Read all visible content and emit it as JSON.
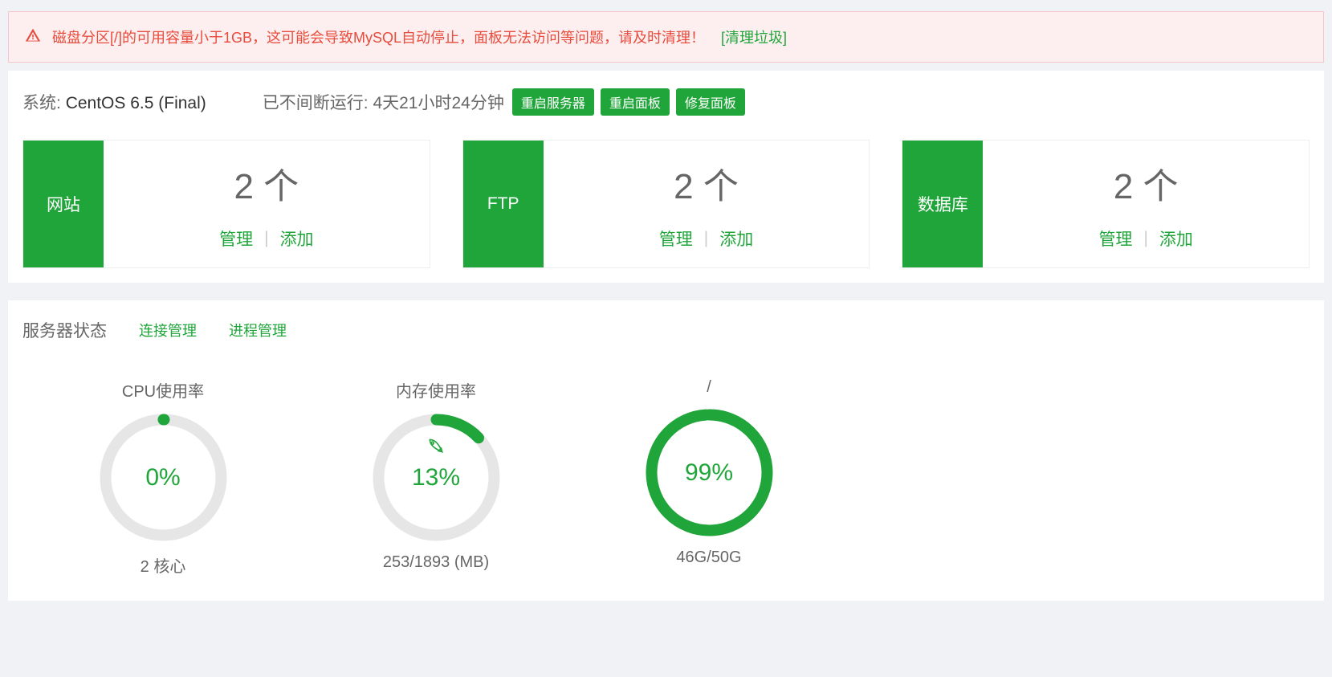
{
  "alert": {
    "message": "磁盘分区[/]的可用容量小于1GB，这可能会导致MySQL自动停止，面板无法访问等问题，请及时清理！",
    "clean_link": "[清理垃圾]"
  },
  "system": {
    "label": "系统:",
    "value": "CentOS 6.5 (Final)",
    "uptime_label": "已不间断运行:",
    "uptime_value": "4天21小时24分钟"
  },
  "buttons": {
    "restart_server": "重启服务器",
    "restart_panel": "重启面板",
    "repair_panel": "修复面板"
  },
  "cards": [
    {
      "label": "网站",
      "count": "2 个",
      "manage": "管理",
      "add": "添加"
    },
    {
      "label": "FTP",
      "count": "2 个",
      "manage": "管理",
      "add": "添加"
    },
    {
      "label": "数据库",
      "count": "2 个",
      "manage": "管理",
      "add": "添加"
    }
  ],
  "status": {
    "title": "服务器状态",
    "connection": "连接管理",
    "process": "进程管理"
  },
  "gauges": [
    {
      "title": "CPU使用率",
      "percent": 0,
      "display": "0%",
      "sub": "2 核心",
      "rocket": false
    },
    {
      "title": "内存使用率",
      "percent": 13,
      "display": "13%",
      "sub": "253/1893 (MB)",
      "rocket": true
    },
    {
      "title": "/",
      "percent": 99,
      "display": "99%",
      "sub": "46G/50G",
      "rocket": false
    }
  ],
  "colors": {
    "green": "#20a53a",
    "red": "#e74c3c",
    "track": "#e6e6e6",
    "alertBg": "#fdefef"
  }
}
